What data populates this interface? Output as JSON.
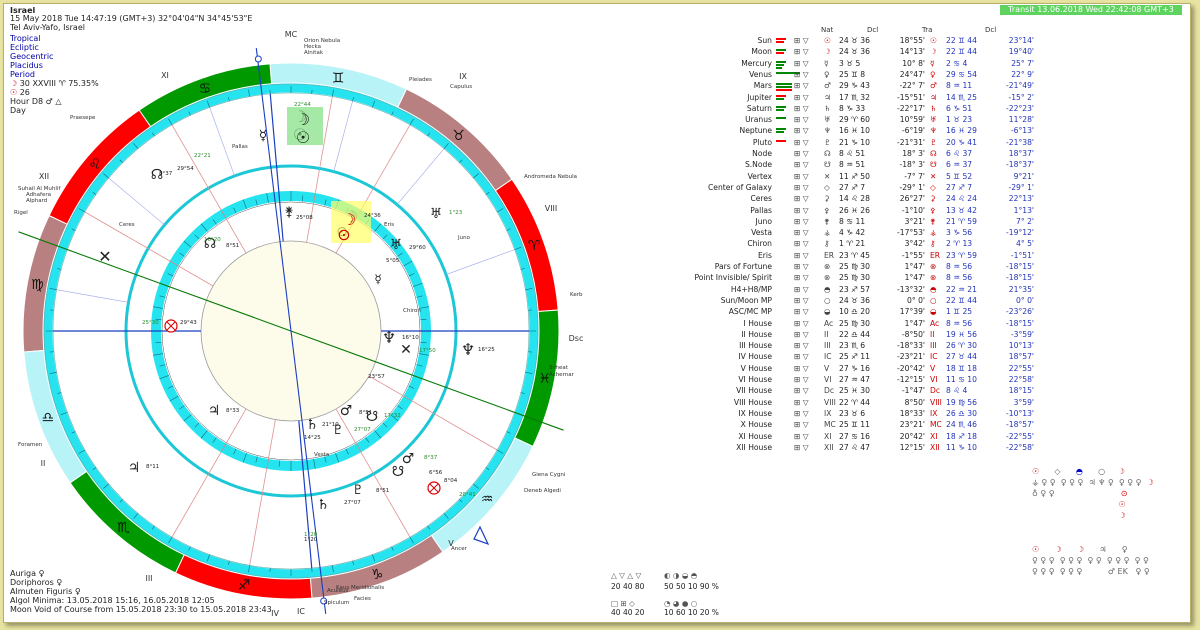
{
  "header": {
    "name": "Israel",
    "datetime": "15 May 2018  Tue  14:47:19 (GMT+3) 32°04'04\"N  34°45'53\"E",
    "place": "Tel Aviv-Yafo, Israel",
    "zodiac": "Tropical",
    "ecliptic": "Ecliptic",
    "geocentric": "Geocentric",
    "houses": "Placidus",
    "period": "Period",
    "period_value": "30 XXVIII ♈ 75.35%",
    "lunar_day": "26",
    "hour": "Hour D8 ♂ △",
    "day": "Day"
  },
  "transit_banner": "Transit 13.06.2018  Wed 22:42:08 GMT+3",
  "table": {
    "col_natal": "Nat",
    "col_decl1": "Dcl",
    "col_transit": "Tra",
    "col_decl2": "Dcl",
    "rows": [
      {
        "name": "Sun",
        "n_pos": "24 ♉ 36",
        "n_dcl": "18°55'",
        "t_pos": "22 ♊ 44",
        "t_dcl": "23°14'"
      },
      {
        "name": "Moon",
        "n_pos": "24 ♉ 36",
        "n_dcl": "14°13'",
        "t_pos": "22 ♊ 44",
        "t_dcl": "19°40'"
      },
      {
        "name": "Mercury",
        "n_pos": "3 ♉ 5",
        "n_dcl": "10° 8'",
        "t_pos": "2 ♋ 4",
        "t_dcl": "25° 7'"
      },
      {
        "name": "Venus",
        "n_pos": "25 ♊ 8",
        "n_dcl": "24°47'",
        "t_pos": "29 ♋ 54",
        "t_dcl": "22° 9'"
      },
      {
        "name": "Mars",
        "n_pos": "29 ♑ 43",
        "n_dcl": "-22° 7'",
        "t_pos": "8 ♒ 11",
        "t_dcl": "-21°49'"
      },
      {
        "name": "Jupiter",
        "n_pos": "17 ♏ 32",
        "n_dcl": "-15°51'",
        "t_pos": "14 ♏ 25",
        "t_dcl": "-15° 2'"
      },
      {
        "name": "Saturn",
        "n_pos": "8 ♑ 33",
        "n_dcl": "-22°17'",
        "t_pos": "6 ♑ 51",
        "t_dcl": "-22°23'"
      },
      {
        "name": "Uranus",
        "n_pos": "29 ♈ 60",
        "n_dcl": "10°59'",
        "t_pos": "1 ♉ 23",
        "t_dcl": "11°28'"
      },
      {
        "name": "Neptune",
        "n_pos": "16 ♓ 10",
        "n_dcl": "-6°19'",
        "t_pos": "16 ♓ 29",
        "t_dcl": "-6°13'"
      },
      {
        "name": "Pluto",
        "n_pos": "21 ♑ 10",
        "n_dcl": "-21°31'",
        "t_pos": "20 ♑ 41",
        "t_dcl": "-21°38'"
      },
      {
        "name": "Node",
        "n_pos": "8 ♌ 51",
        "n_dcl": "18° 3'",
        "t_pos": "6 ♌ 37",
        "t_dcl": "18°37'"
      },
      {
        "name": "S.Node",
        "n_pos": "8 ♒ 51",
        "n_dcl": "-18° 3'",
        "t_pos": "6 ♒ 37",
        "t_dcl": "-18°37'"
      },
      {
        "name": "Vertex",
        "n_pos": "11 ♐ 50",
        "n_dcl": "-7° 7'",
        "t_pos": "5 ♊ 52",
        "t_dcl": "9°21'"
      },
      {
        "name": "Center of Galaxy",
        "n_pos": "27 ♐ 7",
        "n_dcl": "-29° 1'",
        "t_pos": "27 ♐ 7",
        "t_dcl": "-29° 1'"
      },
      {
        "name": "Ceres",
        "n_pos": "14 ♌ 28",
        "n_dcl": "26°27'",
        "t_pos": "24 ♌ 24",
        "t_dcl": "22°13'"
      },
      {
        "name": "Pallas",
        "n_pos": "26 ♓ 26",
        "n_dcl": "-1°10'",
        "t_pos": "13 ♉ 42",
        "t_dcl": "1°13'"
      },
      {
        "name": "Juno",
        "n_pos": "8 ♋ 11",
        "n_dcl": "3°21'",
        "t_pos": "21 ♈ 59",
        "t_dcl": "7° 2'"
      },
      {
        "name": "Vesta",
        "n_pos": "4 ♑ 42",
        "n_dcl": "-17°53'",
        "t_pos": "3 ♑ 56",
        "t_dcl": "-19°12'"
      },
      {
        "name": "Chiron",
        "n_pos": "1 ♈ 21",
        "n_dcl": "3°42'",
        "t_pos": "2 ♈ 13",
        "t_dcl": "4° 5'"
      },
      {
        "name": "Eris",
        "n_pos": "23 ♈ 45",
        "n_dcl": "-1°55'",
        "t_pos": "23 ♈ 59",
        "t_dcl": "-1°51'"
      },
      {
        "name": "Pars of Fortune",
        "n_pos": "25 ♍ 30",
        "n_dcl": "1°47'",
        "t_pos": "8 ♒ 56",
        "t_dcl": "-18°15'"
      },
      {
        "name": "Point Invisible/ Spirit",
        "n_pos": "25 ♍ 30",
        "n_dcl": "1°47'",
        "t_pos": "8 ♒ 56",
        "t_dcl": "-18°15'"
      },
      {
        "name": "H4+H8/MP",
        "n_pos": "23 ♐ 57",
        "n_dcl": "-13°32'",
        "t_pos": "22 ♒ 21",
        "t_dcl": "21°35'"
      },
      {
        "name": "Sun/Moon MP",
        "n_pos": "24 ♉ 36",
        "n_dcl": "0° 0'",
        "t_pos": "22 ♊ 44",
        "t_dcl": "0° 0'"
      },
      {
        "name": "ASC/MC MP",
        "n_pos": "10 ♎ 20",
        "n_dcl": "17°39'",
        "t_pos": "1 ♊ 25",
        "t_dcl": "-23°26'"
      },
      {
        "name": "I House",
        "n_pos": "25 ♍ 30",
        "n_dcl": "1°47'",
        "t_pos": "8 ♒ 56",
        "t_dcl": "-18°15'"
      },
      {
        "name": "II House",
        "n_pos": "22 ♎ 44",
        "n_dcl": "-8°50'",
        "t_pos": "19 ♓ 56",
        "t_dcl": "-3°59'"
      },
      {
        "name": "III House",
        "n_pos": "23 ♏ 6",
        "n_dcl": "-18°33'",
        "t_pos": "26 ♈ 30",
        "t_dcl": "10°13'"
      },
      {
        "name": "IV House",
        "n_pos": "25 ♐ 11",
        "n_dcl": "-23°21'",
        "t_pos": "27 ♉ 44",
        "t_dcl": "18°57'"
      },
      {
        "name": "V House",
        "n_pos": "27 ♑ 16",
        "n_dcl": "-20°42'",
        "t_pos": "18 ♊ 18",
        "t_dcl": "22°55'"
      },
      {
        "name": "VI House",
        "n_pos": "27 ♒ 47",
        "n_dcl": "-12°15'",
        "t_pos": "11 ♋ 10",
        "t_dcl": "22°58'"
      },
      {
        "name": "VII House",
        "n_pos": "25 ♓ 30",
        "n_dcl": "-1°47'",
        "t_pos": "8 ♌ 4",
        "t_dcl": "18°15'"
      },
      {
        "name": "VIII House",
        "n_pos": "22 ♈ 44",
        "n_dcl": "8°50'",
        "t_pos": "19 ♍ 56",
        "t_dcl": "3°59'"
      },
      {
        "name": "IX House",
        "n_pos": "23 ♉ 6",
        "n_dcl": "18°33'",
        "t_pos": "26 ♎ 30",
        "t_dcl": "-10°13'"
      },
      {
        "name": "X House",
        "n_pos": "25 ♊ 11",
        "n_dcl": "23°21'",
        "t_pos": "24 ♏ 46",
        "t_dcl": "-18°57'"
      },
      {
        "name": "XI House",
        "n_pos": "27 ♋ 16",
        "n_dcl": "20°42'",
        "t_pos": "18 ♐ 18",
        "t_dcl": "-22°55'"
      },
      {
        "name": "XII House",
        "n_pos": "27 ♌ 47",
        "n_dcl": "12°15'",
        "t_pos": "11 ♑ 10",
        "t_dcl": "-22°58'"
      }
    ]
  },
  "wheel": {
    "signs": [
      "♈",
      "♉",
      "♊",
      "♋",
      "♌",
      "♍",
      "♎",
      "♏",
      "♐",
      "♑",
      "♒",
      "♓"
    ],
    "house_labels": [
      "XI",
      "XII",
      "II",
      "III",
      "IV",
      "V",
      "VIII",
      "IX",
      "MC",
      "IC",
      "Dsc"
    ],
    "stars": [
      "Orion Nebula",
      "Hecka",
      "Alnitak",
      "Pleiades",
      "Capulus",
      "Andromeda Nebula",
      "Kerb",
      "Scheat",
      "Achernar",
      "Deneb Algedi",
      "Giena Cygni",
      "Ancer",
      "Facies",
      "Aculeus",
      "Spiculum",
      "Kaus Meridionalis",
      "Foramen",
      "Alphard",
      "Adhafera",
      "Suhail Al Muhlif",
      "Praesepe",
      "Rigel"
    ],
    "points": [
      "Pallas",
      "Ceres",
      "Juno",
      "Chiron",
      "Vesta",
      "Eris"
    ],
    "degrees": [
      "22°44",
      "8°37",
      "29°54",
      "22°21",
      "25°08",
      "24°36",
      "1°23",
      "29°60",
      "5°05",
      "10°20",
      "8°51",
      "16°10",
      "17°50",
      "16°25",
      "23°57",
      "25°30",
      "29°43",
      "8°51",
      "17°32",
      "8°33",
      "21°10",
      "27°07",
      "14°25",
      "8°11",
      "8°37",
      "6°56",
      "8°04",
      "20°41",
      "8°51",
      "27°07",
      "1°20",
      "1°20"
    ]
  },
  "footer": {
    "line1": "Auriga  ♀",
    "line2": "Doriphoros  ♀",
    "line3": "Almuten Figuris  ♀",
    "line4": "Algol Minima: 13.05.2018 15:16,  16.05.2018 12:05",
    "line5": "Moon Void of Course from 15.05.2018 23:30 to 15.05.2018 23:43"
  },
  "element_stats": {
    "row1": [
      "20",
      "40",
      "80"
    ],
    "row2": [
      "40",
      "40",
      "20"
    ],
    "row3": [
      "50",
      "50",
      "10",
      "90",
      "%"
    ],
    "row4": [
      "10",
      "60",
      "10",
      "20",
      "%"
    ]
  },
  "colors": {
    "red": "#ff0000",
    "green": "#009900",
    "rose": "#b88080",
    "cyan": "#26e4ef",
    "lightcyan": "#b7f3f7",
    "cream": "#fdfcea",
    "blue": "#0033cc"
  }
}
